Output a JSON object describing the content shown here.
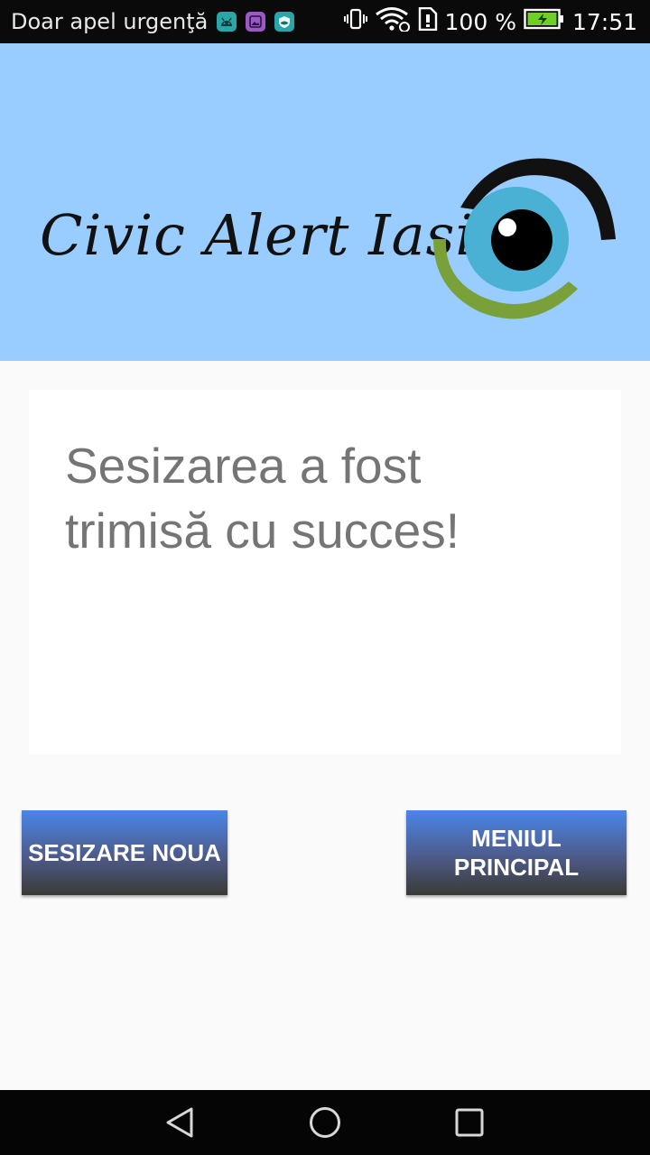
{
  "status_bar": {
    "carrier_text": "Doar apel urgenţă",
    "battery_percent": "100 %",
    "time": "17:51",
    "notification_icons": [
      "android-icon",
      "gallery-icon",
      "shield-icon"
    ],
    "system_icons": [
      "vibrate-icon",
      "wifi-icon",
      "sim-icon",
      "battery-icon"
    ]
  },
  "header": {
    "logo_text": "Civic Alert Iasi",
    "banner_color": "#99ccff"
  },
  "card": {
    "message": "Sesizarea a fost trimisă cu succes!"
  },
  "buttons": {
    "new_report_label": "SESIZARE NOUA",
    "main_menu_label": "MENIUL PRINCIPAL"
  },
  "nav_bar": {
    "icons": [
      "back-icon",
      "home-icon",
      "recents-icon"
    ]
  },
  "colors": {
    "accent_blue": "#4a86e8",
    "eye_blue": "#4ab0d4",
    "eye_green": "#7aa03a",
    "message_gray": "#757575"
  }
}
